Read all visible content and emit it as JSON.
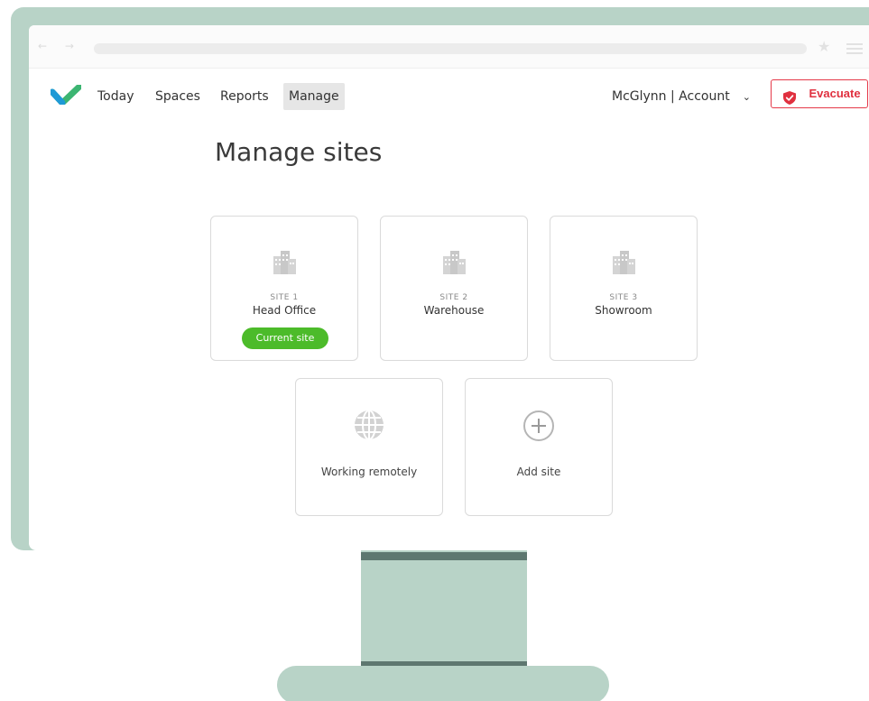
{
  "nav": {
    "items": [
      {
        "label": "Today"
      },
      {
        "label": "Spaces"
      },
      {
        "label": "Reports"
      },
      {
        "label": "Manage"
      }
    ],
    "account_label": "McGlynn | Account",
    "evacuate_label": "Evacuate"
  },
  "page": {
    "title": "Manage sites"
  },
  "sites": [
    {
      "number": "SITE 1",
      "name": "Head Office",
      "badge": "Current site"
    },
    {
      "number": "SITE 2",
      "name": "Warehouse"
    },
    {
      "number": "SITE 3",
      "name": "Showroom"
    }
  ],
  "actions": {
    "remote_label": "Working remotely",
    "add_label": "Add site"
  },
  "colors": {
    "brand_green": "#4cbb2a",
    "evacuate_red": "#e0303f",
    "monitor": "#b8d3c7"
  }
}
